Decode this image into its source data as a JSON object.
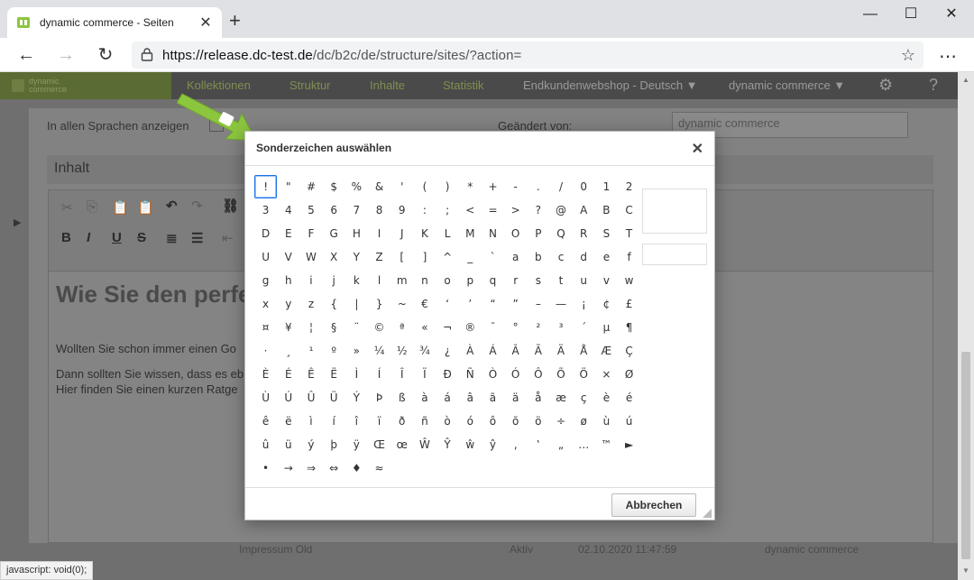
{
  "browser": {
    "tab_title": "dynamic commerce - Seiten",
    "tab_close": "✕",
    "new_tab": "+",
    "url_host": "https://release.dc-test.de",
    "url_path": "/dc/b2c/de/structure/sites/?action=",
    "window": {
      "minimize": "—",
      "maximize": "☐",
      "close": "✕"
    },
    "back": "←",
    "forward": "→",
    "reload": "↻",
    "favorite": "☆",
    "more": "⋯"
  },
  "app": {
    "logo_text": "dynamic commerce",
    "nav": [
      "Kollektionen",
      "Struktur",
      "Inhalte",
      "Statistik"
    ],
    "shop_select": "Endkundenwebshop - Deutsch ▼",
    "user_select": "dynamic commerce ▼",
    "settings_icon": "⚙",
    "help_icon": "?"
  },
  "editor": {
    "show_all_languages": "In allen Sprachen anzeigen",
    "changed_by_label": "Geändert von:",
    "changed_by_value": "dynamic commerce",
    "section_title": "Inhalt",
    "content_heading": "Wie Sie den perfe",
    "paragraph_1": "Wollten Sie schon immer einen Go",
    "paragraph_2": "Dann sollten Sie wissen, dass es eb",
    "paragraph_3": "Hier finden Sie einen kurzen Ratge",
    "toolbar": {
      "bold": "B",
      "italic": "I",
      "underline": "U",
      "strike": "S"
    }
  },
  "background_row": {
    "name": "Impressum Old",
    "status": "Aktiv",
    "date": "02.10.2020 11:47:59",
    "author": "dynamic commerce"
  },
  "status_bar": "javascript: void(0);",
  "dialog": {
    "title": "Sonderzeichen auswählen",
    "close": "✕",
    "cancel_label": "Abbrechen",
    "selected_index": 0,
    "characters": [
      "!",
      "\"",
      "#",
      "$",
      "%",
      "&",
      "'",
      "(",
      ")",
      "*",
      "+",
      "-",
      ".",
      "/",
      "0",
      "1",
      "2",
      "3",
      "4",
      "5",
      "6",
      "7",
      "8",
      "9",
      ":",
      ";",
      "<",
      "=",
      ">",
      "?",
      "@",
      "A",
      "B",
      "C",
      "D",
      "E",
      "F",
      "G",
      "H",
      "I",
      "J",
      "K",
      "L",
      "M",
      "N",
      "O",
      "P",
      "Q",
      "R",
      "S",
      "T",
      "U",
      "V",
      "W",
      "X",
      "Y",
      "Z",
      "[",
      "]",
      "^",
      "_",
      "`",
      "a",
      "b",
      "c",
      "d",
      "e",
      "f",
      "g",
      "h",
      "i",
      "j",
      "k",
      "l",
      "m",
      "n",
      "o",
      "p",
      "q",
      "r",
      "s",
      "t",
      "u",
      "v",
      "w",
      "x",
      "y",
      "z",
      "{",
      "|",
      "}",
      "~",
      "€",
      "‘",
      "’",
      "“",
      "”",
      "–",
      "—",
      "¡",
      "¢",
      "£",
      "¤",
      "¥",
      "¦",
      "§",
      "¨",
      "©",
      "ª",
      "«",
      "¬",
      "®",
      "¯",
      "°",
      "²",
      "³",
      "´",
      "µ",
      "¶",
      "·",
      "¸",
      "¹",
      "º",
      "»",
      "¼",
      "½",
      "¾",
      "¿",
      "À",
      "Á",
      "Â",
      "Ã",
      "Ä",
      "Å",
      "Æ",
      "Ç",
      "È",
      "É",
      "Ê",
      "Ë",
      "Ì",
      "Í",
      "Î",
      "Ï",
      "Ð",
      "Ñ",
      "Ò",
      "Ó",
      "Ô",
      "Õ",
      "Ö",
      "×",
      "Ø",
      "Ù",
      "Ú",
      "Û",
      "Ü",
      "Ý",
      "Þ",
      "ß",
      "à",
      "á",
      "â",
      "ã",
      "ä",
      "å",
      "æ",
      "ç",
      "è",
      "é",
      "ê",
      "ë",
      "ì",
      "í",
      "î",
      "ï",
      "ð",
      "ñ",
      "ò",
      "ó",
      "ô",
      "õ",
      "ö",
      "÷",
      "ø",
      "ù",
      "ú",
      "û",
      "ü",
      "ý",
      "þ",
      "ÿ",
      "Œ",
      "œ",
      "Ŵ",
      "Ŷ",
      "ŵ",
      "ŷ",
      "‚",
      "‛",
      "„",
      "…",
      "™",
      "►",
      "•",
      "→",
      "⇒",
      "⇔",
      "♦",
      "≈"
    ]
  },
  "colors": {
    "accent_green": "#8cc63f",
    "selection_blue": "#1a73e8"
  }
}
